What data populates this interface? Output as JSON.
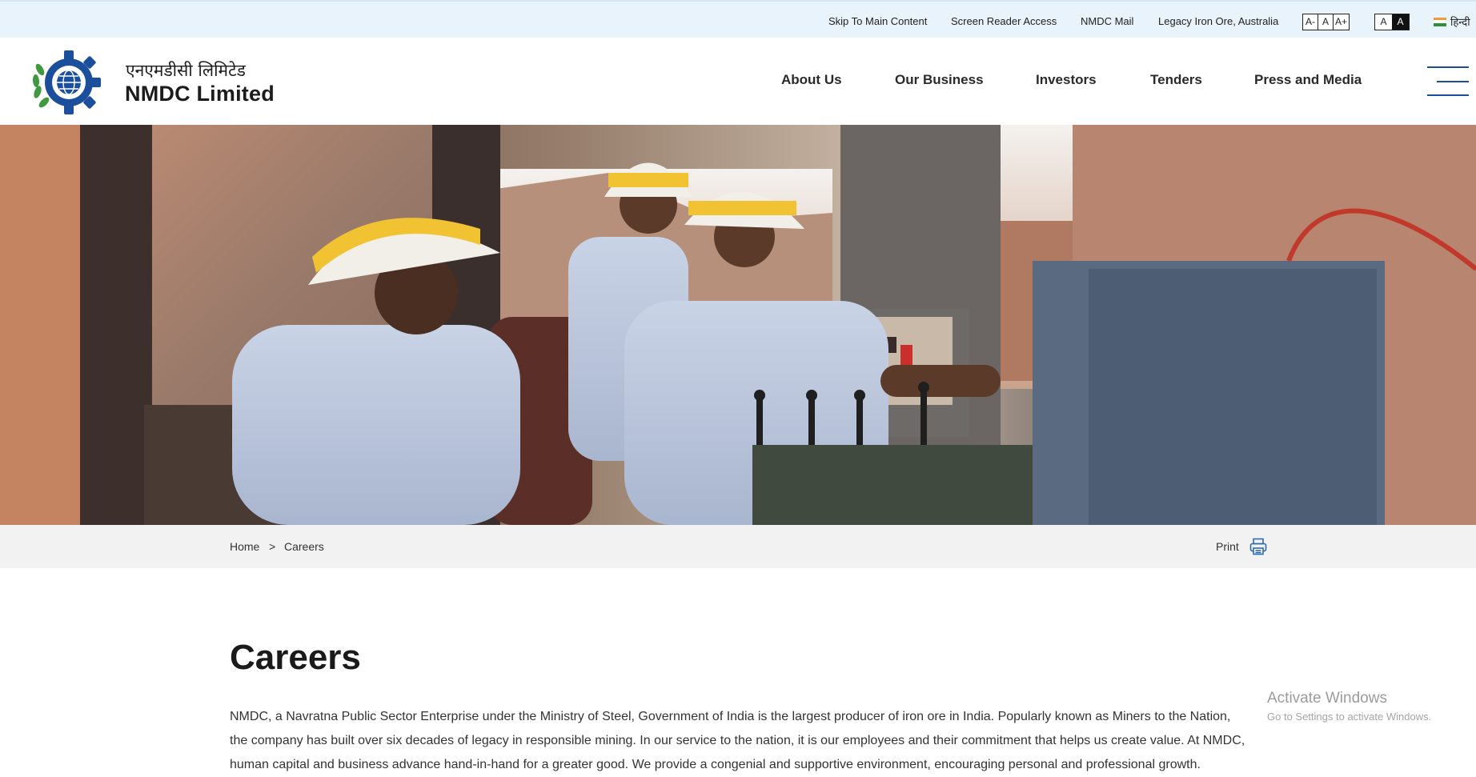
{
  "utility": {
    "skip": "Skip To Main Content",
    "screen_reader": "Screen Reader Access",
    "mail": "NMDC Mail",
    "legacy": "Legacy Iron Ore, Australia",
    "font_sizes": [
      "A-",
      "A",
      "A+"
    ],
    "contrast": [
      "A",
      "A"
    ],
    "language": "हिन्दी"
  },
  "brand": {
    "hindi": "एनएमडीसी लिमिटेड",
    "name": "NMDC Limited"
  },
  "nav": {
    "items": [
      "About Us",
      "Our Business",
      "Investors",
      "Tenders",
      "Press and Media"
    ]
  },
  "breadcrumb": {
    "home": "Home",
    "separator": ">",
    "current": "Careers",
    "print": "Print"
  },
  "content": {
    "title": "Careers",
    "intro": "NMDC, a Navratna Public Sector Enterprise under the Ministry of Steel, Government of India is the largest producer of iron ore in India. Popularly known as Miners to the Nation, the company has built over six decades of legacy in responsible mining. In our service to the nation, it is our employees and their commitment that helps us create value. At NMDC, human capital and business advance hand-in-hand for a greater good. We provide a congenial and supportive environment, encouraging personal and professional growth."
  },
  "watermark": {
    "title": "Activate Windows",
    "subtitle": "Go to Settings to activate Windows."
  },
  "colors": {
    "accent_blue": "#1b4f9c",
    "logo_green": "#3f9a3f",
    "utility_bg": "#e8f3fb"
  }
}
